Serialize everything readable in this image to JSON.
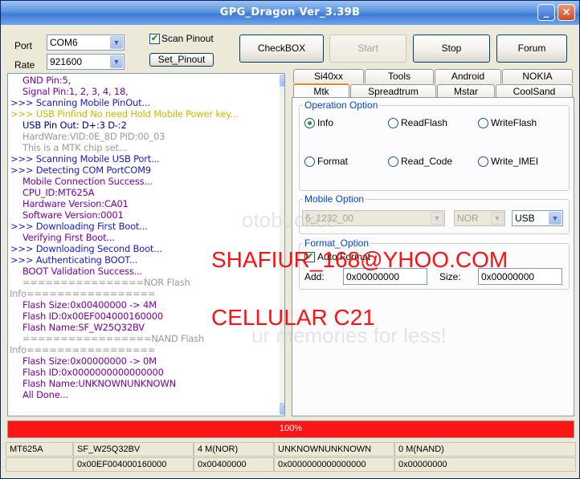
{
  "window": {
    "title": "GPG_Dragon  Ver_3.39B",
    "min_glyph": "_",
    "close_glyph": "×"
  },
  "port": {
    "label": "Port",
    "value": "COM6"
  },
  "rate": {
    "label": "Rate",
    "value": "921600"
  },
  "scan_pinout": {
    "label": "Scan Pinout",
    "checked": true
  },
  "set_pinout": {
    "label": "Set_Pinout"
  },
  "buttons": {
    "checkbox": "CheckBOX",
    "start": "Start",
    "stop": "Stop",
    "forum": "Forum"
  },
  "log": [
    {
      "text": "GND Pin:5,",
      "color": "purple"
    },
    {
      "text": "Signal Pin:1, 2, 3, 4, 18,",
      "color": "purple"
    },
    {
      "text": ">>> Scanning Mobile PinOut...",
      "color": "blue"
    },
    {
      "text": ">>> USB Pinfind No need Hold Mobile Power key...",
      "color": "yellow"
    },
    {
      "text": "USB Pin Out: D+:3  D-:2",
      "color": "navy"
    },
    {
      "text": "HardWare:VID:0E_8D PID:00_03",
      "color": "gray"
    },
    {
      "text": "This is a MTK chip set...",
      "color": "gray"
    },
    {
      "text": ">>> Scanning Mobile USB Port...",
      "color": "blue"
    },
    {
      "text": ">>> Detecting COM PortCOM9",
      "color": "blue"
    },
    {
      "text": "Mobile Connection Success...",
      "color": "purple"
    },
    {
      "text": "CPU_ID:MT625A",
      "color": "purple"
    },
    {
      "text": "Hardware Version:CA01",
      "color": "purple"
    },
    {
      "text": "Software Version:0001",
      "color": "purple"
    },
    {
      "text": ">>> Downloading First Boot...",
      "color": "blue"
    },
    {
      "text": "Verifying First Boot...",
      "color": "purple"
    },
    {
      "text": ">>> Downloading Second Boot...",
      "color": "blue"
    },
    {
      "text": ">>> Authenticating BOOT...",
      "color": "blue"
    },
    {
      "text": "BOOT Validation Success...",
      "color": "purple"
    },
    {
      "text": "================NOR Flash",
      "color": "gray"
    },
    {
      "text": "Info=================",
      "color": "gray"
    },
    {
      "text": "Flash Size:0x00400000 -> 4M",
      "color": "purple"
    },
    {
      "text": "Flash ID:0x00EF004000160000",
      "color": "purple"
    },
    {
      "text": "Flash Name:SF_W25Q32BV",
      "color": "purple"
    },
    {
      "text": "=================NAND Flash",
      "color": "gray"
    },
    {
      "text": "Info=================",
      "color": "gray"
    },
    {
      "text": "Flash Size:0x00000000 -> 0M",
      "color": "purple"
    },
    {
      "text": "Flash ID:0x0000000000000000",
      "color": "purple"
    },
    {
      "text": "Flash Name:UNKNOWNUNKNOWN",
      "color": "purple"
    },
    {
      "text": "All Done...",
      "color": "purple"
    }
  ],
  "tabs_row1": [
    "Si40xx",
    "Tools",
    "Android",
    "NOKIA"
  ],
  "tabs_row2": [
    "Mtk",
    "Spreadtrum",
    "Mstar",
    "CoolSand"
  ],
  "operation": {
    "title": "Operation Option",
    "options": [
      "Info",
      "ReadFlash",
      "WriteFlash",
      "Format",
      "Read_Code",
      "Write_IMEI"
    ],
    "selected": "Info"
  },
  "mobile_option": {
    "title": "Mobile Option",
    "model": "6_1232_00",
    "flash": "NOR",
    "port": "USB"
  },
  "format_option": {
    "title": "Format_Option",
    "auto_format": "Auto Format",
    "add_label": "Add:",
    "add_value": "0x00000000",
    "size_label": "Size:",
    "size_value": "0x00000000"
  },
  "progress": {
    "text": "100%",
    "value": 100
  },
  "status_row1": [
    "MT625A",
    "SF_W25Q32BV",
    "4 M(NOR)",
    "UNKNOWNUNKNOWN",
    "0 M(NAND)"
  ],
  "status_row2": [
    "",
    "0x00EF004000160000",
    "0x00400000",
    "0x0000000000000000",
    "0x00000000"
  ],
  "overlay": {
    "email": "SHAFIUR_168@YHOO.COM",
    "model": "CELLULAR C21",
    "ghost1": "otobucket",
    "ghost2": "ur memories for less!"
  },
  "colors": {
    "progress": "#fd1515",
    "titlebar": "#3f7bd6",
    "overlay_text": "#ff1010",
    "group_title": "#0046d5"
  }
}
